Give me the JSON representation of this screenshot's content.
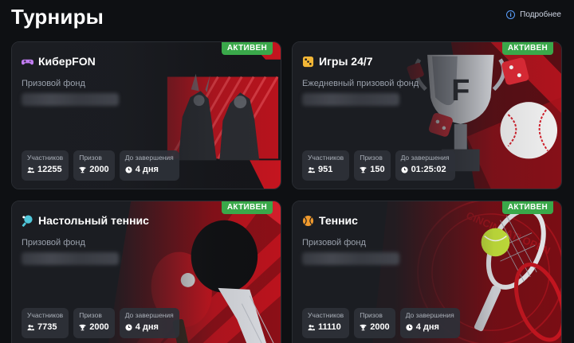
{
  "page": {
    "title": "Турниры",
    "more_label": "Подробнее"
  },
  "status_labels": {
    "active": "АКТИВЕН"
  },
  "stat_labels": {
    "participants": "Участников",
    "prizes": "Призов",
    "ends": "До завершения"
  },
  "colors": {
    "background": "#0e1013",
    "card": "#1b1d22",
    "active_badge": "#3aa84a",
    "accent_red": "#d31f2b",
    "link_icon": "#5aa0ff"
  },
  "tournaments": [
    {
      "title": "КиберFON",
      "icon": "gamepad-icon",
      "fund_label": "Призовой фонд",
      "fund_value": "",
      "status": "АКТИВЕН",
      "participants": "12255",
      "prizes": "2000",
      "ends": "4 дня"
    },
    {
      "title": "Игры 24/7",
      "icon": "dice-icon",
      "fund_label": "Ежедневный призовой фонд",
      "fund_value": "",
      "status": "АКТИВЕН",
      "participants": "951",
      "prizes": "150",
      "ends": "01:25:02"
    },
    {
      "title": "Настольный теннис",
      "icon": "table-tennis-icon",
      "fund_label": "Призовой фонд",
      "fund_value": "",
      "status": "АКТИВЕН",
      "participants": "7735",
      "prizes": "2000",
      "ends": "4 дня"
    },
    {
      "title": "Теннис",
      "icon": "tennis-ball-icon",
      "fund_label": "Призовой фонд",
      "fund_value": "",
      "status": "АКТИВЕН",
      "participants": "11110",
      "prizes": "2000",
      "ends": "4 дня"
    }
  ]
}
